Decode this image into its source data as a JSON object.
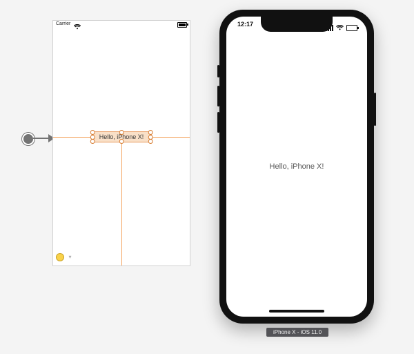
{
  "interface_builder": {
    "status_bar": {
      "carrier": "Carrier"
    },
    "selected_label_text": "Hello, iPhone X!",
    "warning_indicator": "layout-warning"
  },
  "device": {
    "status_bar": {
      "time": "12:17"
    },
    "greeting_text": "Hello, iPhone X!",
    "caption": "iPhone X - iOS 11.0"
  }
}
